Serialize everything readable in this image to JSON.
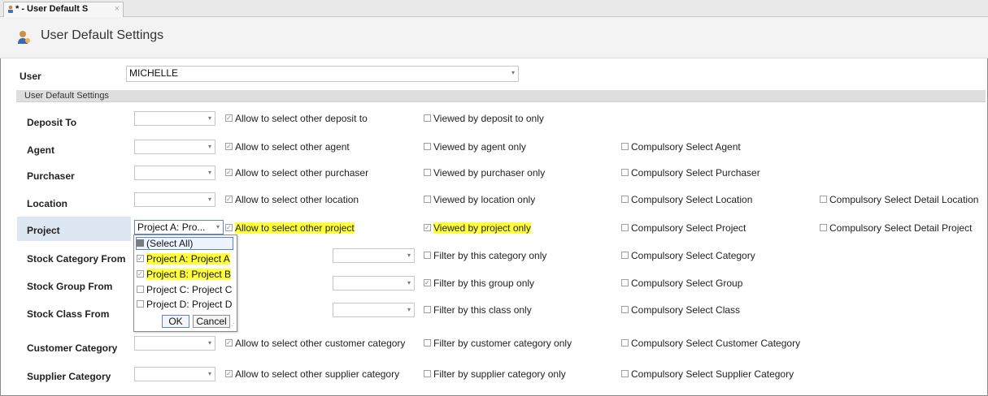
{
  "tab": {
    "title": "* - User Default S",
    "close": "×"
  },
  "page": {
    "title": "User Default Settings"
  },
  "user": {
    "label": "User",
    "value": "MICHELLE"
  },
  "group": {
    "title": "User Default Settings"
  },
  "rows": [
    {
      "label": "Deposit To",
      "combo": "",
      "allow": "Allow to select other deposit to",
      "allow_checked": true,
      "viewed": "Viewed by deposit to only",
      "viewed_checked": false
    },
    {
      "label": "Agent",
      "combo": "",
      "allow": "Allow to select other agent",
      "allow_checked": true,
      "viewed": "Viewed by agent only",
      "viewed_checked": false,
      "comp": "Compulsory Select Agent"
    },
    {
      "label": "Purchaser",
      "combo": "",
      "allow": "Allow to select other purchaser",
      "allow_checked": true,
      "viewed": "Viewed by purchaser only",
      "viewed_checked": false,
      "comp": "Compulsory Select Purchaser"
    },
    {
      "label": "Location",
      "combo": "",
      "allow": "Allow to select other location",
      "allow_checked": true,
      "viewed": "Viewed by location only",
      "viewed_checked": false,
      "comp": "Compulsory Select Location",
      "detail": "Compulsory Select Detail Location"
    },
    {
      "label": "Project",
      "combo": "Project A: Pro...",
      "allow": "Allow to select other project",
      "allow_checked": true,
      "viewed": "Viewed by project only",
      "viewed_checked": true,
      "comp": "Compulsory Select Project",
      "detail": "Compulsory Select Detail Project"
    },
    {
      "label": "Stock Category From",
      "combo": "",
      "filter": "Filter by this category only",
      "filter_checked": false,
      "comp": "Compulsory Select Category"
    },
    {
      "label": "Stock Group From",
      "combo": "",
      "filter": "Filter by this group only",
      "filter_checked": true,
      "comp": "Compulsory Select Group"
    },
    {
      "label": "Stock Class From",
      "combo": "",
      "filter": "Filter by this class only",
      "filter_checked": false,
      "comp": "Compulsory Select Class"
    },
    {
      "label": "Customer Category",
      "combo": "",
      "allow": "Allow to select other customer category",
      "allow_checked": true,
      "viewed": "Filter by customer category only",
      "viewed_checked": false,
      "comp": "Compulsory Select Customer Category"
    },
    {
      "label": "Supplier Category",
      "combo": "",
      "allow": "Allow to select other supplier category",
      "allow_checked": true,
      "viewed": "Filter by supplier category only",
      "viewed_checked": false,
      "comp": "Compulsory Select Supplier Category"
    }
  ],
  "dropdown": {
    "items": [
      {
        "label": "(Select All)",
        "state": "partial"
      },
      {
        "label": "Project A: Project A",
        "checked": true
      },
      {
        "label": "Project B: Project B",
        "checked": true
      },
      {
        "label": "Project C: Project C",
        "checked": false
      },
      {
        "label": "Project D: Project D",
        "checked": false
      }
    ],
    "ok": "OK",
    "cancel": "Cancel"
  },
  "colors": {
    "highlight": "#ffff3b",
    "active_row": "#dde6f3",
    "group_bar": "#dedede"
  },
  "icons": {
    "tab": "user-settings-icon",
    "title": "user-settings-icon"
  }
}
